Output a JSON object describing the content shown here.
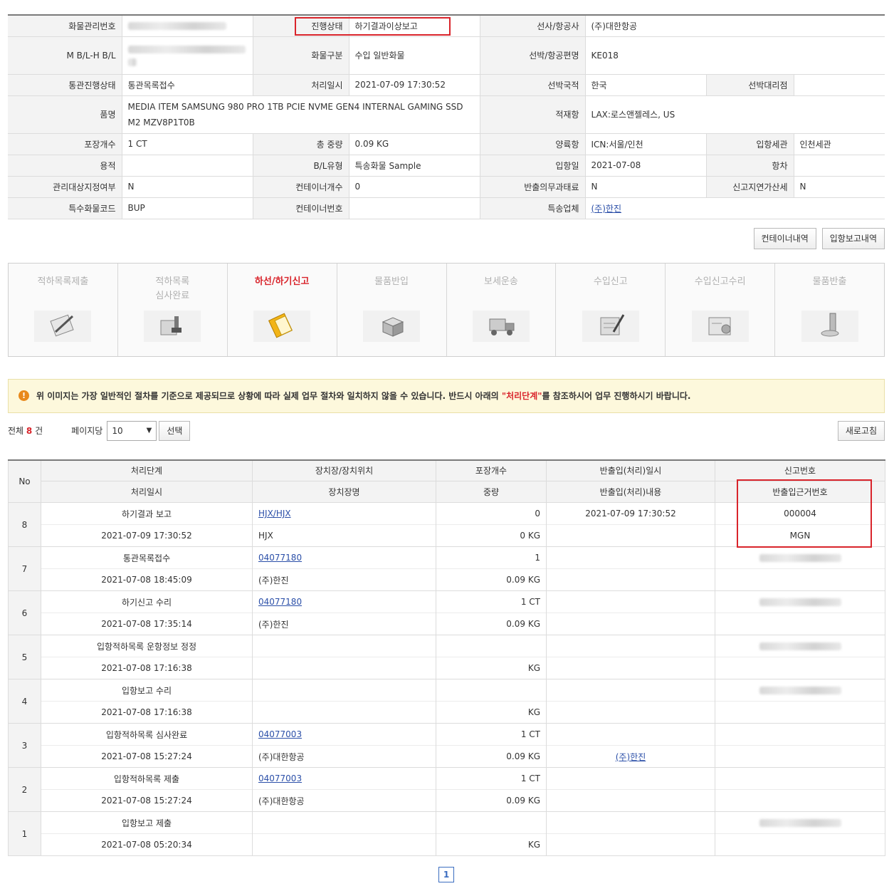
{
  "info": {
    "cargo_no_label": "화물관리번호",
    "status_label": "진행상태",
    "status_value": "하기결과이상보고",
    "carrier_label": "선사/항공사",
    "carrier_value": "(주)대한항공",
    "mbl_label": "M B/L-H B/L",
    "cargo_type_label": "화물구분",
    "cargo_type_value": "수입 일반화물",
    "flight_label": "선박/항공편명",
    "flight_value": "KE018",
    "customs_status_label": "통관진행상태",
    "customs_status_value": "통관목록접수",
    "proc_date_label": "처리일시",
    "proc_date_value": "2021-07-09 17:30:52",
    "nationality_label": "선박국적",
    "nationality_value": "한국",
    "agent_label": "선박대리점",
    "item_label": "품명",
    "item_value": "MEDIA ITEM SAMSUNG 980 PRO 1TB PCIE NVME GEN4 INTERNAL GAMING SSD M2 MZV8P1T0B",
    "loading_port_label": "적재항",
    "loading_port_value": "LAX:로스앤젤레스, US",
    "pkg_label": "포장개수",
    "pkg_value": "1 CT",
    "weight_label": "총 중량",
    "weight_value": "0.09 KG",
    "unloading_port_label": "양륙항",
    "unloading_port_value": "ICN:서울/인천",
    "entry_customs_label": "입항세관",
    "entry_customs_value": "인천세관",
    "volume_label": "용적",
    "bl_type_label": "B/L유형",
    "bl_type_value": "특송화물 Sample",
    "entry_date_label": "입항일",
    "entry_date_value": "2021-07-08",
    "voyage_label": "항차",
    "managed_label": "관리대상지정여부",
    "managed_value": "N",
    "container_count_label": "컨테이너개수",
    "container_count_value": "0",
    "release_overdue_label": "반출의무과태료",
    "release_overdue_value": "N",
    "late_penalty_label": "신고지연가산세",
    "late_penalty_value": "N",
    "special_code_label": "특수화물코드",
    "special_code_value": "BUP",
    "container_no_label": "컨테이너번호",
    "express_label": "특송업체",
    "express_value": "(주)한진"
  },
  "buttons": {
    "container_history": "컨테이너내역",
    "entry_report_history": "입항보고내역",
    "choose": "선택",
    "refresh": "새로고침"
  },
  "steps": [
    {
      "label": "적하목록제출",
      "icon": "clipboard-pen-icon",
      "active": false
    },
    {
      "label": "적하목록\n심사완료",
      "icon": "stamp-icon",
      "active": false
    },
    {
      "label": "하선/하기신고",
      "icon": "notebook-icon",
      "active": true
    },
    {
      "label": "물품반입",
      "icon": "box-icon",
      "active": false
    },
    {
      "label": "보세운송",
      "icon": "truck-icon",
      "active": false
    },
    {
      "label": "수입신고",
      "icon": "document-pen-icon",
      "active": false
    },
    {
      "label": "수입신고수리",
      "icon": "certificate-icon",
      "active": false
    },
    {
      "label": "물품반출",
      "icon": "release-icon",
      "active": false
    }
  ],
  "notice": {
    "pre": "위 이미지는 가장 일반적인 절차를 기준으로 제공되므로 상황에 따라 실제 업무 절차와 일치하지 않을 수 있습니다. 반드시 아래의 ",
    "highlight": "\"처리단계\"",
    "post": "를 참조하시어 업무 진행하시기 바랍니다."
  },
  "list_toolbar": {
    "total_pre": "전체",
    "total_count": "8",
    "total_post": "건",
    "per_page_label": "페이지당",
    "per_page_value": "10"
  },
  "list_headers": {
    "no": "No",
    "step": "처리단계",
    "step_sub": "처리일시",
    "warehouse": "장치장/장치위치",
    "warehouse_sub": "장치장명",
    "pkg": "포장개수",
    "pkg_sub": "중량",
    "release": "반출입(처리)일시",
    "release_sub": "반출입(처리)내용",
    "report": "신고번호",
    "report_sub": "반출입근거번호"
  },
  "rows": [
    {
      "no": "8",
      "step": "하기결과 보고",
      "date": "2021-07-09 17:30:52",
      "wh": "HJX/HJX",
      "wh_link": true,
      "wh_name": "HJX",
      "pkg": "0",
      "weight": "0 KG",
      "release_date": "2021-07-09 17:30:52",
      "release_content": "",
      "report": "000004",
      "report_blur": false,
      "basis": "MGN"
    },
    {
      "no": "7",
      "step": "통관목록접수",
      "date": "2021-07-08 18:45:09",
      "wh": "04077180",
      "wh_link": true,
      "wh_name": "(주)한진",
      "pkg": "1",
      "weight": "0.09 KG",
      "release_date": "",
      "release_content": "",
      "report": "",
      "report_blur": true,
      "basis": ""
    },
    {
      "no": "6",
      "step": "하기신고 수리",
      "date": "2021-07-08 17:35:14",
      "wh": "04077180",
      "wh_link": true,
      "wh_name": "(주)한진",
      "pkg": "1 CT",
      "weight": "0.09 KG",
      "release_date": "",
      "release_content": "",
      "report": "",
      "report_blur": true,
      "basis": ""
    },
    {
      "no": "5",
      "step": "입항적하목록 운항정보 정정",
      "date": "2021-07-08 17:16:38",
      "wh": "",
      "wh_link": false,
      "wh_name": "",
      "pkg": "",
      "weight": "KG",
      "release_date": "",
      "release_content": "",
      "report": "",
      "report_blur": true,
      "basis": ""
    },
    {
      "no": "4",
      "step": "입항보고 수리",
      "date": "2021-07-08 17:16:38",
      "wh": "",
      "wh_link": false,
      "wh_name": "",
      "pkg": "",
      "weight": "KG",
      "release_date": "",
      "release_content": "",
      "report": "",
      "report_blur": true,
      "basis": ""
    },
    {
      "no": "3",
      "step": "입항적하목록 심사완료",
      "date": "2021-07-08 15:27:24",
      "wh": "04077003",
      "wh_link": true,
      "wh_name": "(주)대한항공",
      "pkg": "1 CT",
      "weight": "0.09 KG",
      "release_date": "",
      "release_content": "(주)한진",
      "report": "",
      "report_blur": false,
      "basis": ""
    },
    {
      "no": "2",
      "step": "입항적하목록 제출",
      "date": "2021-07-08 15:27:24",
      "wh": "04077003",
      "wh_link": true,
      "wh_name": "(주)대한항공",
      "pkg": "1 CT",
      "weight": "0.09 KG",
      "release_date": "",
      "release_content": "",
      "report": "",
      "report_blur": false,
      "basis": ""
    },
    {
      "no": "1",
      "step": "입항보고 제출",
      "date": "2021-07-08 05:20:34",
      "wh": "",
      "wh_link": false,
      "wh_name": "",
      "pkg": "",
      "weight": "KG",
      "release_date": "",
      "release_content": "",
      "report": "",
      "report_blur": true,
      "basis": ""
    }
  ],
  "pager": {
    "current": "1"
  },
  "colors": {
    "accent_red": "#d9242b",
    "link": "#2b4fa8",
    "warning": "#e8891c"
  }
}
